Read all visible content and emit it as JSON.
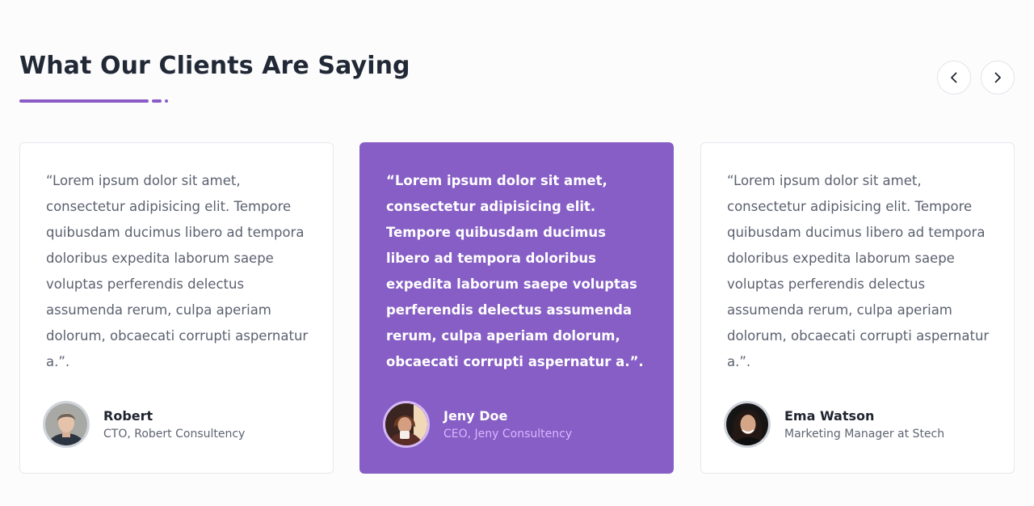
{
  "section": {
    "title": "What Our Clients Are Saying"
  },
  "colors": {
    "accent": "#8A5CC5",
    "highlight_card": "#865EC5",
    "highlight_role": "#D9B6FF"
  },
  "navigation": {
    "previous_icon": "chevron-left-icon",
    "next_icon": "chevron-right-icon"
  },
  "testimonials": [
    {
      "quote": "“Lorem ipsum dolor sit amet, consectetur adipisicing elit. Tempore quibusdam ducimus libero ad tempora doloribus expedita laborum saepe voluptas perferendis delectus assumenda rerum, culpa aperiam dolorum, obcaecati corrupti aspernatur a.”.",
      "name": "Robert",
      "role": "CTO, Robert Consultency",
      "highlighted": false
    },
    {
      "quote": "“Lorem ipsum dolor sit amet, consectetur adipisicing elit. Tempore quibusdam ducimus libero ad tempora doloribus expedita laborum saepe voluptas perferendis delectus assumenda rerum, culpa aperiam dolorum, obcaecati corrupti aspernatur a.”.",
      "name": "Jeny Doe",
      "role": "CEO, Jeny Consultency",
      "highlighted": true
    },
    {
      "quote": "“Lorem ipsum dolor sit amet, consectetur adipisicing elit. Tempore quibusdam ducimus libero ad tempora doloribus expedita laborum saepe voluptas perferendis delectus assumenda rerum, culpa aperiam dolorum, obcaecati corrupti aspernatur a.”.",
      "name": "Ema Watson",
      "role": "Marketing Manager at Stech",
      "highlighted": false
    }
  ]
}
